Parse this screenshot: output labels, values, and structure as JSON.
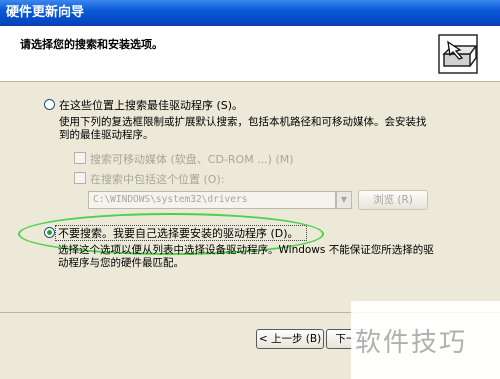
{
  "window": {
    "title": "硬件更新向导"
  },
  "header": {
    "text": "请选择您的搜索和安装选项。"
  },
  "option_search": {
    "label": "在这些位置上搜索最佳驱动程序 (S)。",
    "description_line1": "使用下列的复选框限制或扩展默认搜索，包括本机路径和可移动媒体。会安装找",
    "description_line2": "到的最佳驱动程序。",
    "checkbox_removable": "搜索可移动媒体 (软盘、CD-ROM ...) (M)",
    "checkbox_location": "在搜索中包括这个位置 (O):",
    "path_value": "C:\\WINDOWS\\system32\\drivers",
    "browse_label": "浏览 (R)"
  },
  "option_manual": {
    "label": "不要搜索。我要自己选择要安装的驱动程序 (D)。",
    "description_line1": "选择这个选项以便从列表中选择设备驱动程序。Windows 不能保证您所选择的驱",
    "description_line2": "动程序与您的硬件最匹配。"
  },
  "footer": {
    "back_label": "< 上一步 (B)",
    "next_label": "下一"
  },
  "watermark": {
    "text": "软件技巧"
  }
}
